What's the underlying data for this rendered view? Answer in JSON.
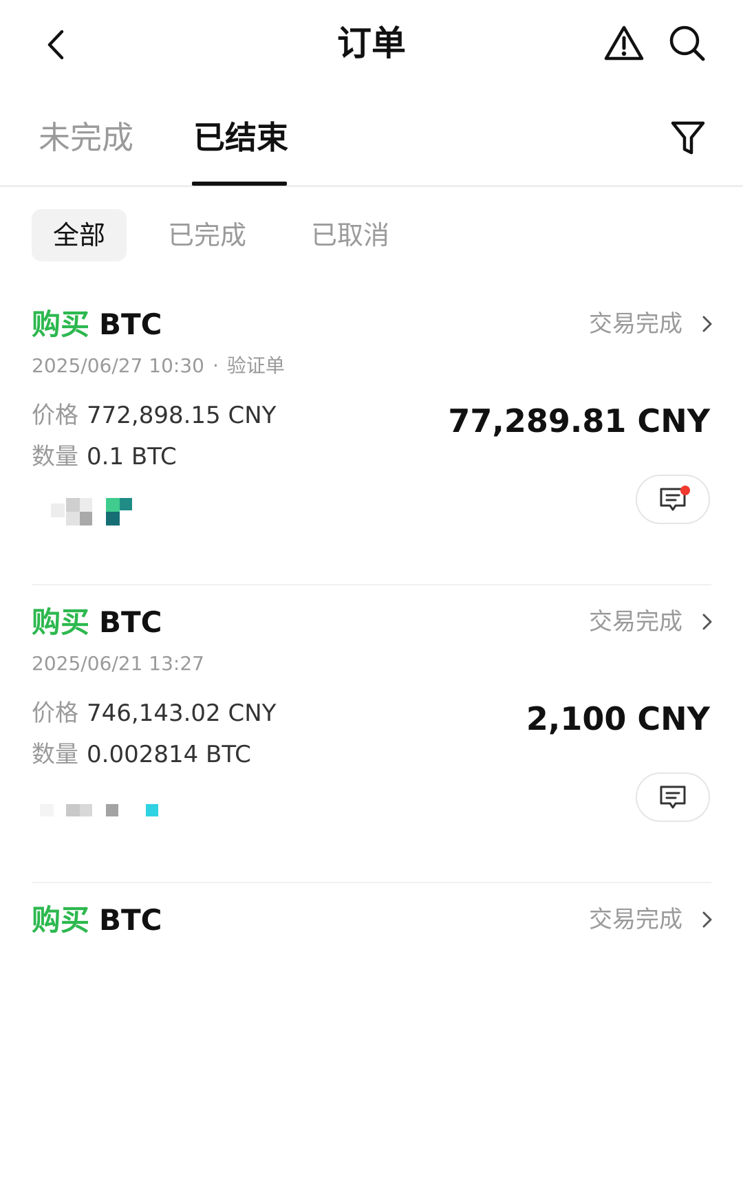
{
  "header": {
    "title": "订单",
    "back_icon": "chevron-left-icon",
    "warning_icon": "warning-triangle-icon",
    "search_icon": "search-icon"
  },
  "tabs": [
    {
      "label": "未完成",
      "active": false
    },
    {
      "label": "已结束",
      "active": true
    }
  ],
  "filter_icon": "filter-icon",
  "subtabs": [
    {
      "label": "全部",
      "active": true
    },
    {
      "label": "已完成",
      "active": false
    },
    {
      "label": "已取消",
      "active": false
    }
  ],
  "orders": [
    {
      "side": "购买",
      "asset": "BTC",
      "status": "交易完成",
      "datetime": "2025/06/27 10:30",
      "dot": "·",
      "tag": "验证单",
      "price_label": "价格",
      "price": "772,898.15 CNY",
      "qty_label": "数量",
      "qty": "0.1 BTC",
      "total": "77,289.81 CNY",
      "chat_unread": true
    },
    {
      "side": "购买",
      "asset": "BTC",
      "status": "交易完成",
      "datetime": "2025/06/21 13:27",
      "price_label": "价格",
      "price": "746,143.02 CNY",
      "qty_label": "数量",
      "qty": "0.002814 BTC",
      "total": "2,100 CNY",
      "chat_unread": false
    },
    {
      "side": "购买",
      "asset": "BTC",
      "status": "交易完成"
    }
  ],
  "colors": {
    "buy_green": "#2db84f",
    "muted_gray": "#9a9a9a",
    "unread_red": "#f0392f"
  }
}
